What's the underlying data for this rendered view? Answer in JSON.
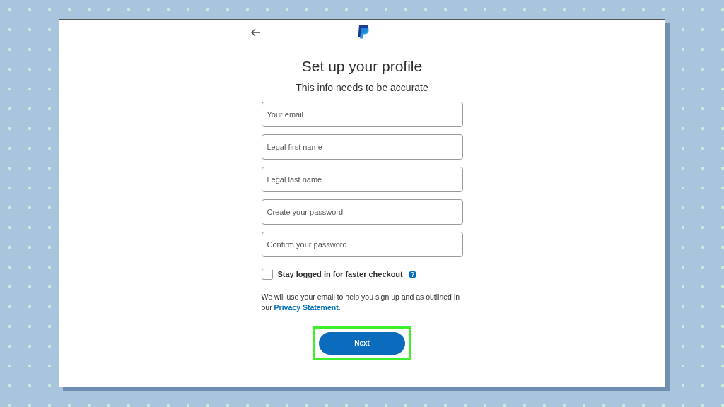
{
  "title": "Set up your profile",
  "subtitle": "This info needs to be accurate",
  "fields": [
    {
      "placeholder": "Your email"
    },
    {
      "placeholder": "Legal first name"
    },
    {
      "placeholder": "Legal last name"
    },
    {
      "placeholder": "Create your password"
    },
    {
      "placeholder": "Confirm your password"
    }
  ],
  "stay_logged_in": {
    "label": "Stay logged in for faster checkout",
    "checked": false
  },
  "notice": {
    "before": "We will use your email to help you sign up and as outlined in our",
    "link": "Privacy Statement",
    "after": "."
  },
  "next_button": {
    "label": "Next",
    "highlighted": true
  }
}
